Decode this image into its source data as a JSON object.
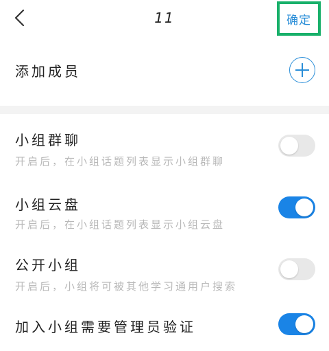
{
  "header": {
    "title": "11",
    "confirm_label": "确定"
  },
  "add_member": {
    "label": "添加成员"
  },
  "settings": [
    {
      "title": "小组群聊",
      "description": "开启后，在小组话题列表显示小组群聊",
      "enabled": false
    },
    {
      "title": "小组云盘",
      "description": "开启后，在小组话题列表显示小组云盘",
      "enabled": true
    },
    {
      "title": "公开小组",
      "description": "开启后，小组将可被其他学习通用户搜索",
      "enabled": false
    },
    {
      "title": "加入小组需要管理员验证",
      "enabled": true
    }
  ],
  "colors": {
    "accent": "#2a8ed8",
    "toggle_on": "#1a84e6",
    "toggle_off": "#e8e8e8",
    "highlight_border": "#18b06a"
  },
  "icons": {
    "back": "chevron-left-icon",
    "add": "plus-circle-icon"
  }
}
